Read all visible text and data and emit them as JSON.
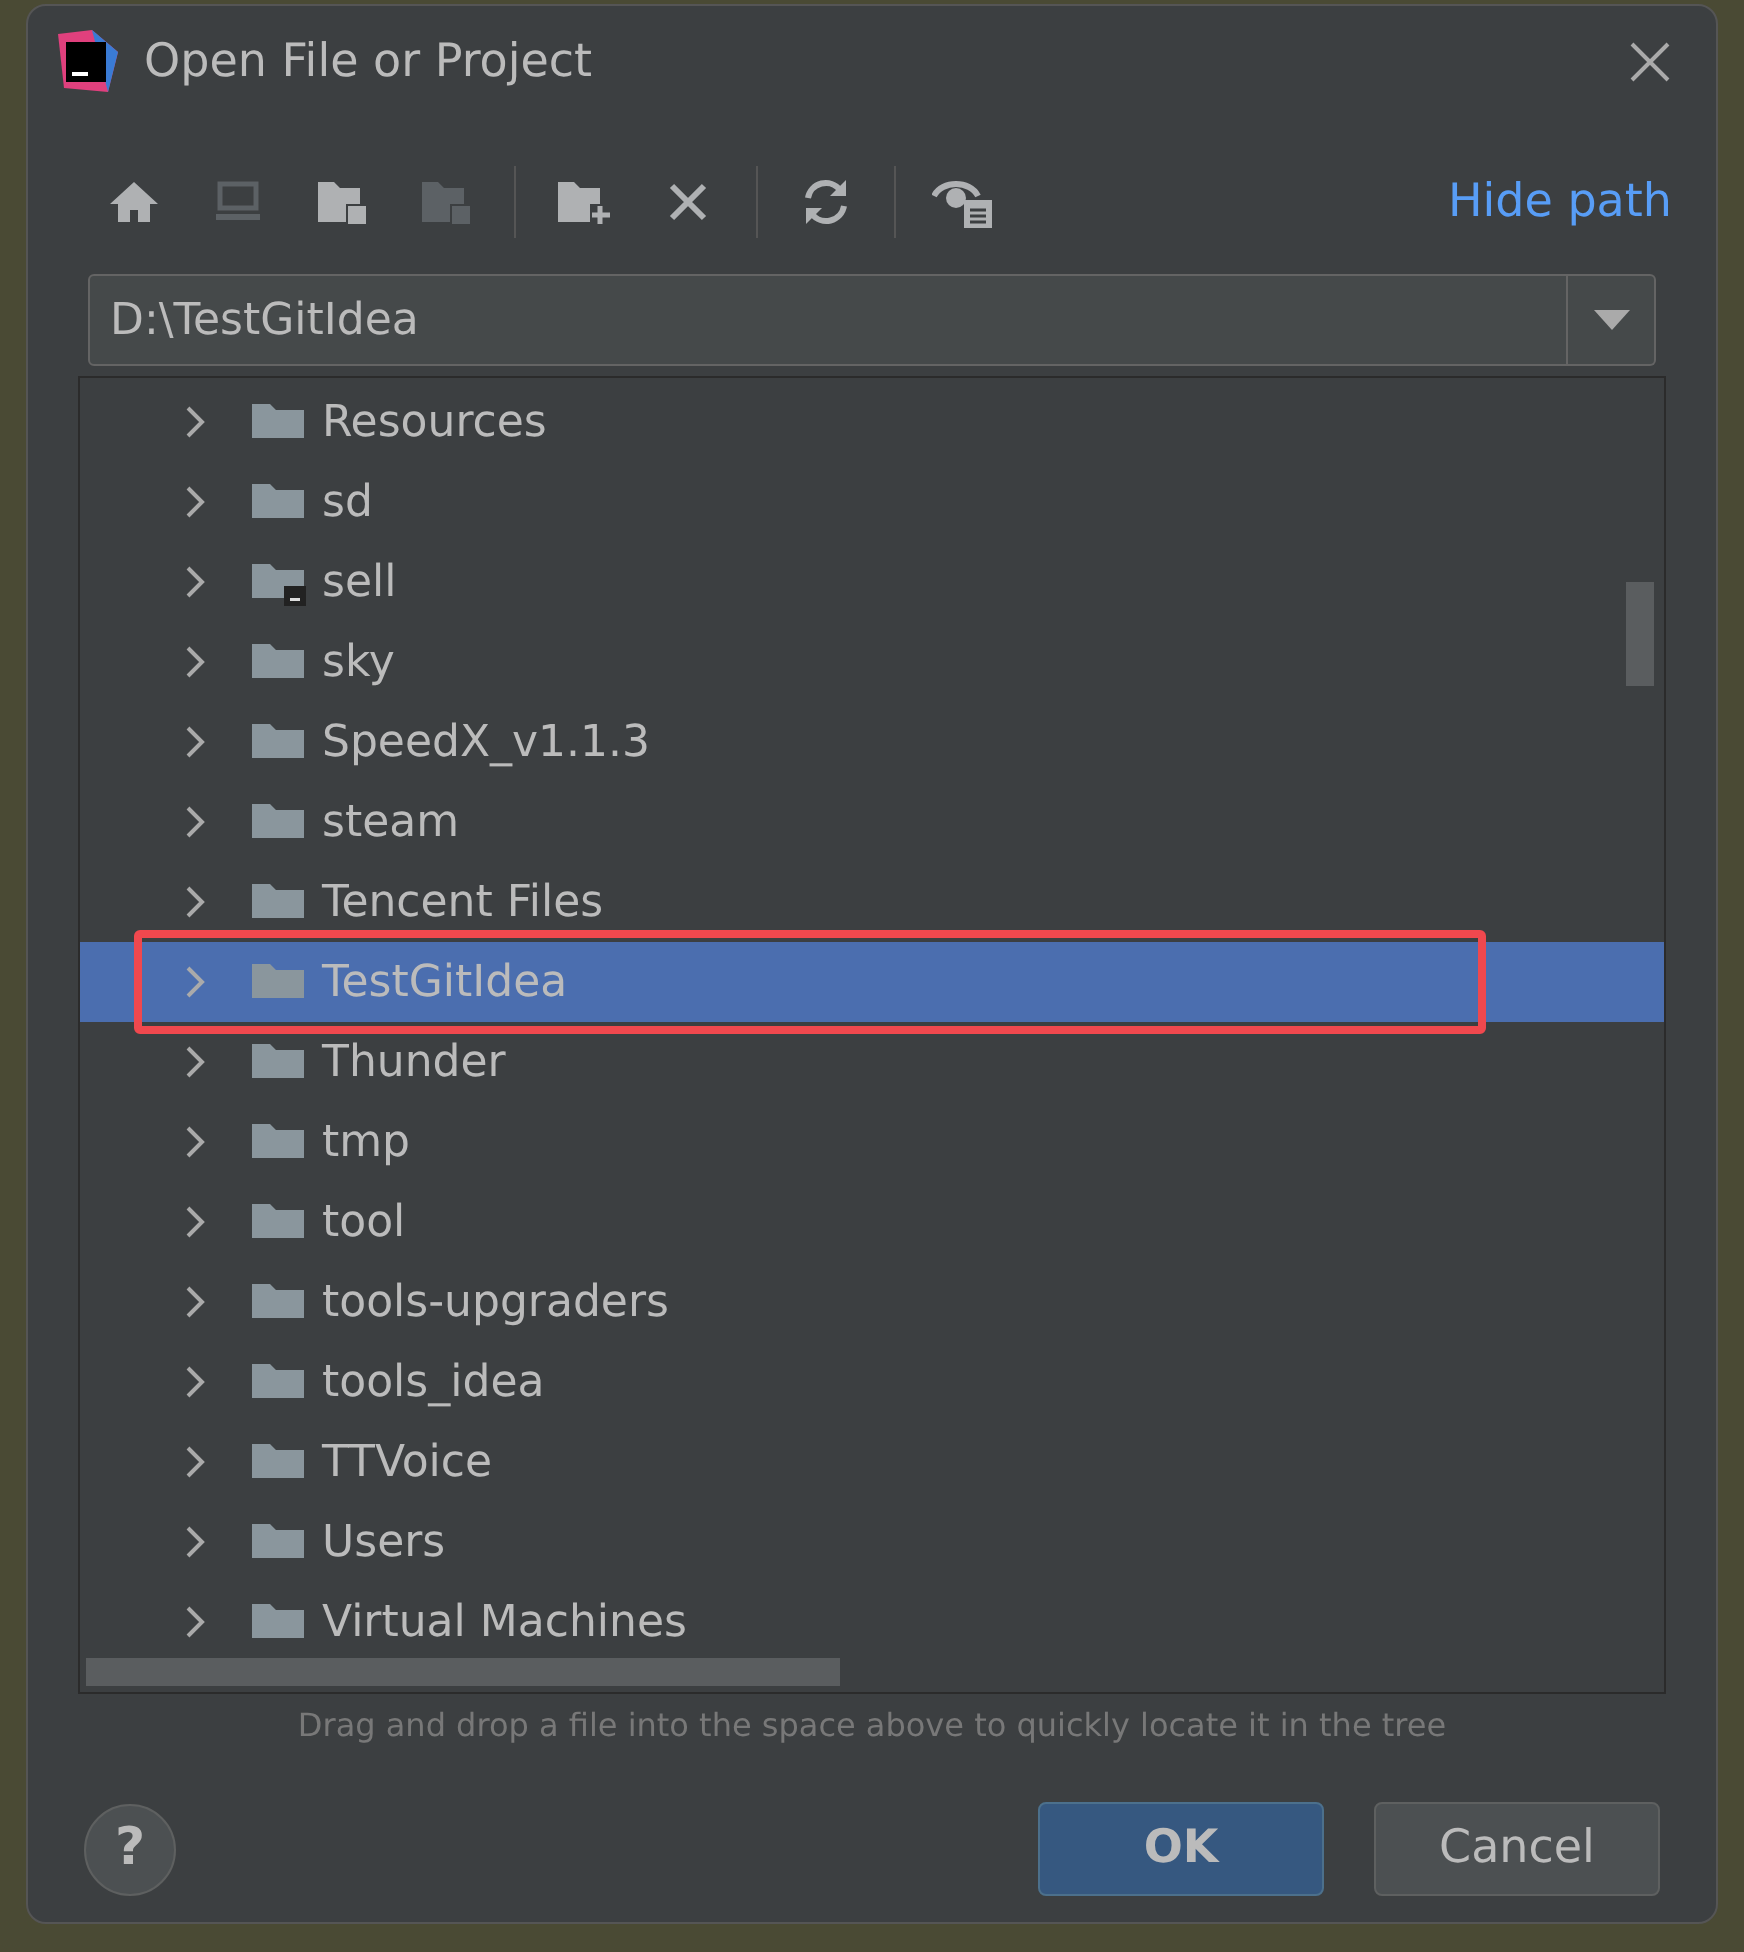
{
  "window": {
    "title": "Open File or Project"
  },
  "toolbar": {
    "tools": [
      {
        "kind": "home",
        "disabled": false
      },
      {
        "kind": "desktop",
        "disabled": true
      },
      {
        "kind": "project",
        "disabled": false
      },
      {
        "kind": "module",
        "disabled": true
      },
      {
        "kind": "sep"
      },
      {
        "kind": "new-folder",
        "disabled": false
      },
      {
        "kind": "delete",
        "disabled": false
      },
      {
        "kind": "sep"
      },
      {
        "kind": "refresh",
        "disabled": false
      },
      {
        "kind": "sep"
      },
      {
        "kind": "hidden",
        "disabled": false
      }
    ],
    "hide_path_link": "Hide path"
  },
  "path_field": {
    "value": "D:\\TestGitIdea"
  },
  "tree": {
    "items": [
      {
        "name": "Resources",
        "kind": "folder",
        "expanded": false,
        "selected": false,
        "highlighted": false
      },
      {
        "name": "sd",
        "kind": "folder",
        "expanded": false,
        "selected": false,
        "highlighted": false
      },
      {
        "name": "sell",
        "kind": "module",
        "expanded": false,
        "selected": false,
        "highlighted": false
      },
      {
        "name": "sky",
        "kind": "folder",
        "expanded": false,
        "selected": false,
        "highlighted": false
      },
      {
        "name": "SpeedX_v1.1.3",
        "kind": "folder",
        "expanded": false,
        "selected": false,
        "highlighted": false
      },
      {
        "name": "steam",
        "kind": "folder",
        "expanded": false,
        "selected": false,
        "highlighted": false
      },
      {
        "name": "Tencent Files",
        "kind": "folder",
        "expanded": false,
        "selected": false,
        "highlighted": false
      },
      {
        "name": "TestGitIdea",
        "kind": "folder",
        "expanded": false,
        "selected": true,
        "highlighted": true
      },
      {
        "name": "Thunder",
        "kind": "folder",
        "expanded": false,
        "selected": false,
        "highlighted": false
      },
      {
        "name": "tmp",
        "kind": "folder",
        "expanded": false,
        "selected": false,
        "highlighted": false
      },
      {
        "name": "tool",
        "kind": "folder",
        "expanded": false,
        "selected": false,
        "highlighted": false
      },
      {
        "name": "tools-upgraders",
        "kind": "folder",
        "expanded": false,
        "selected": false,
        "highlighted": false
      },
      {
        "name": "tools_idea",
        "kind": "folder",
        "expanded": false,
        "selected": false,
        "highlighted": false
      },
      {
        "name": "TTVoice",
        "kind": "folder",
        "expanded": false,
        "selected": false,
        "highlighted": false
      },
      {
        "name": "Users",
        "kind": "folder",
        "expanded": false,
        "selected": false,
        "highlighted": false
      },
      {
        "name": "Virtual Machines",
        "kind": "folder",
        "expanded": false,
        "selected": false,
        "highlighted": false
      }
    ]
  },
  "hint": "Drag and drop a file into the space above to quickly locate it in the tree",
  "help_button": "?",
  "buttons": [
    {
      "label": "OK",
      "kind": "primary"
    },
    {
      "label": "Cancel",
      "kind": "secondary"
    }
  ]
}
